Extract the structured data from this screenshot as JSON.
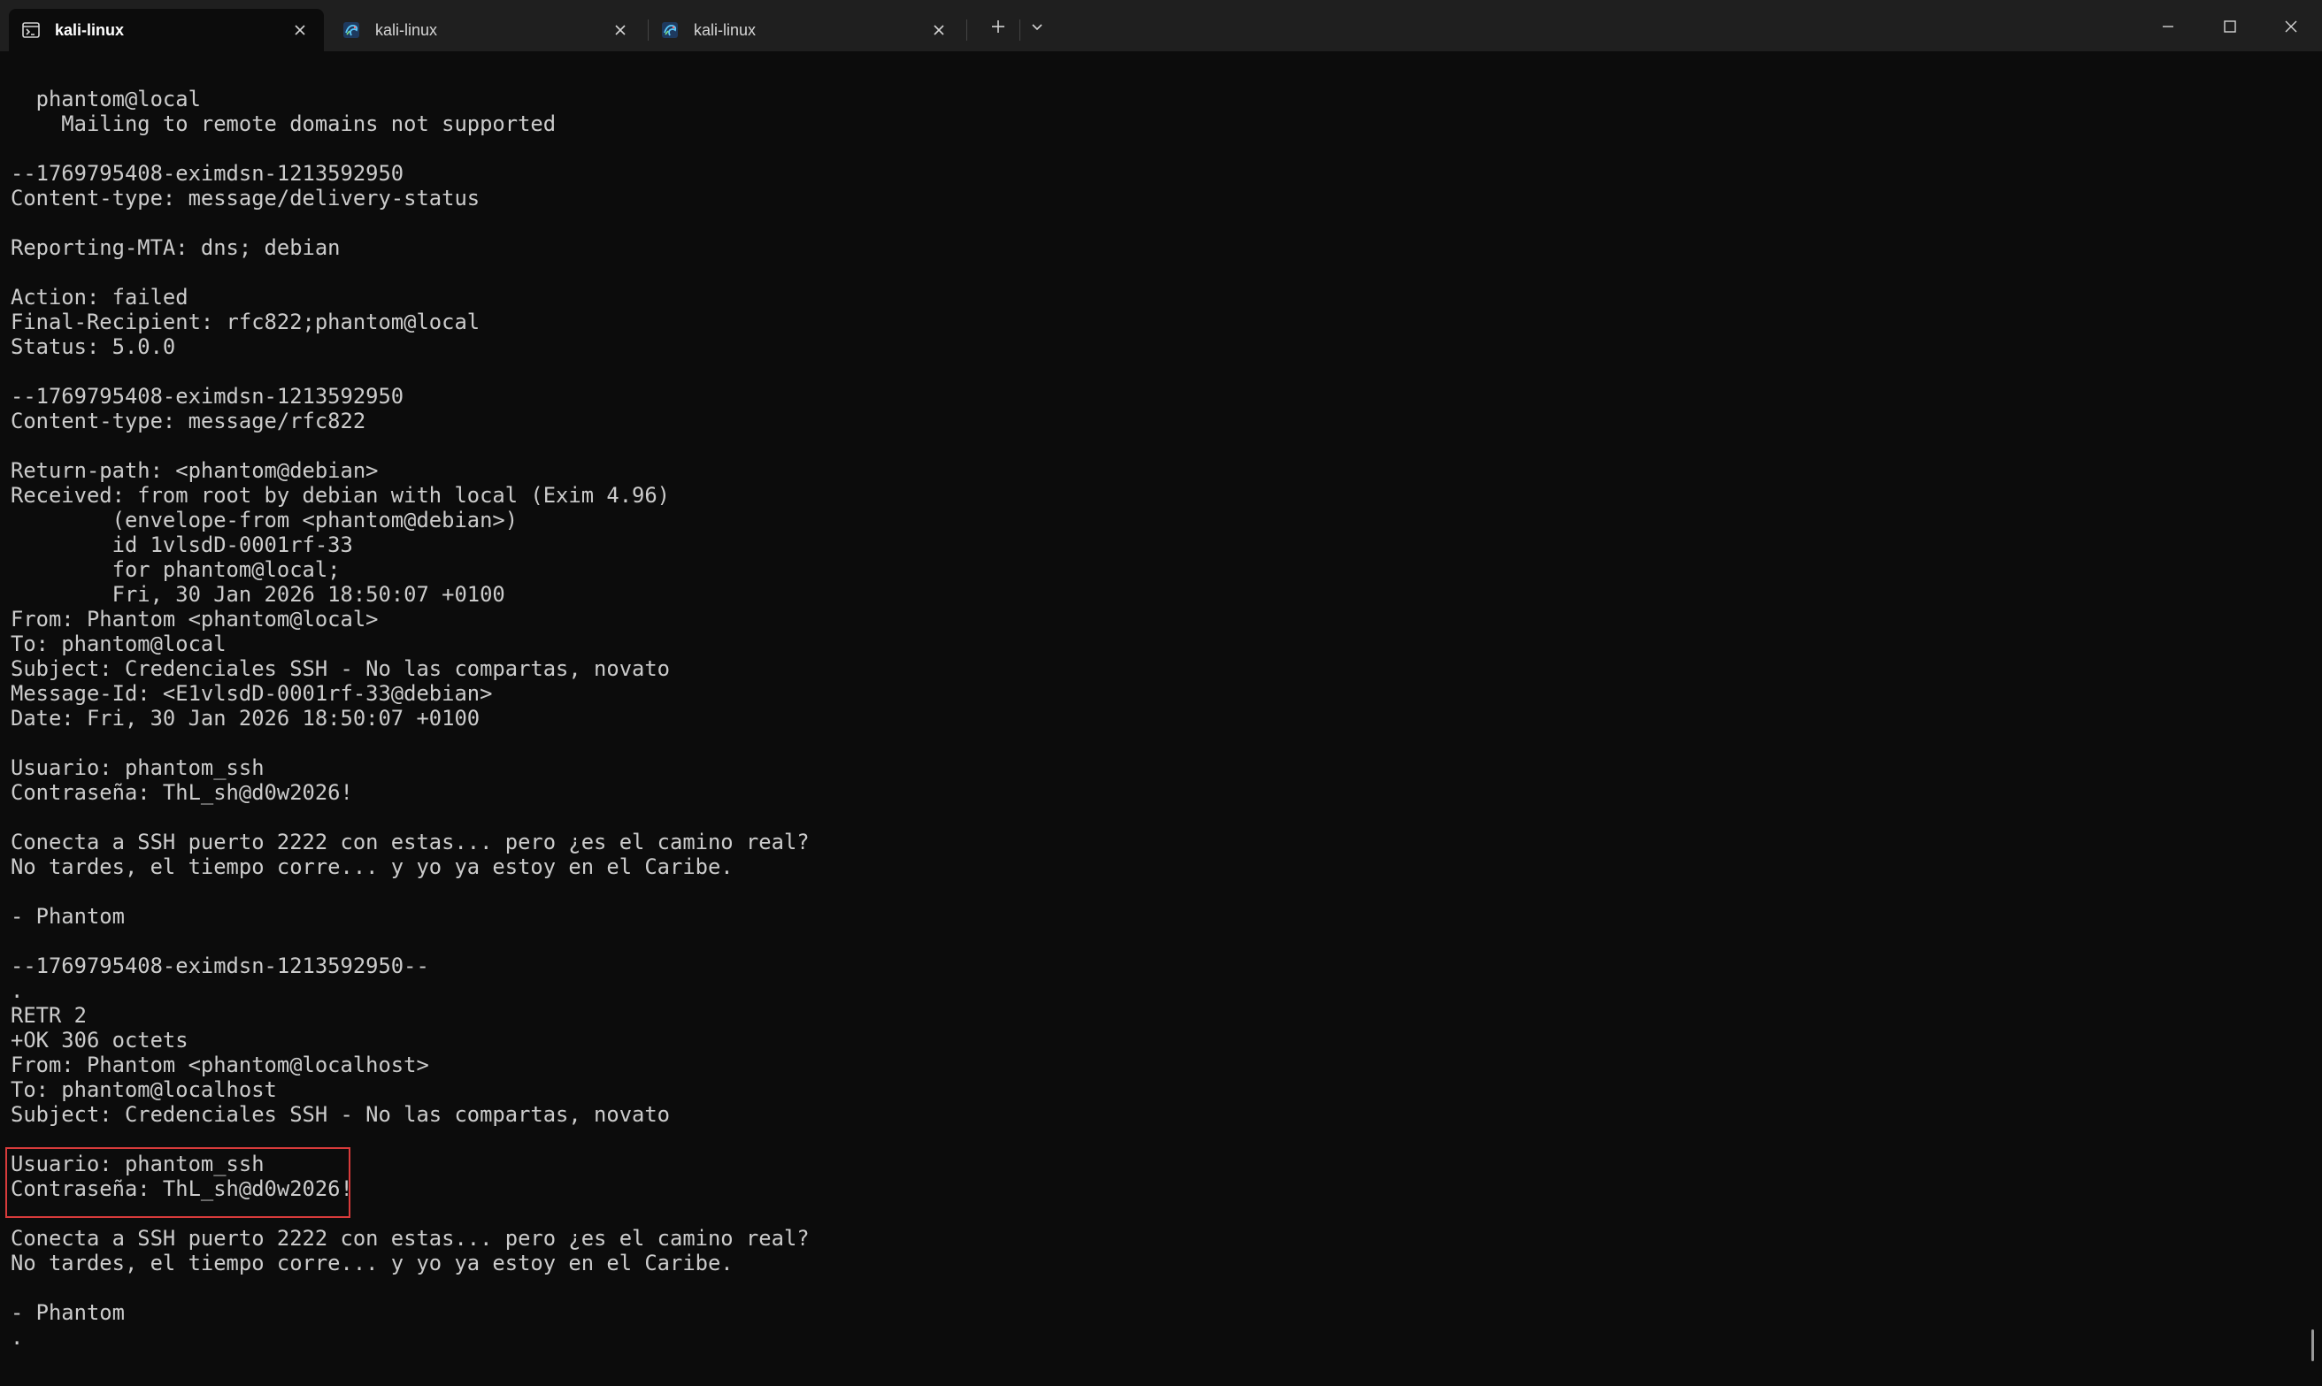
{
  "window": {
    "tabs": [
      {
        "label": "kali-linux",
        "active": true,
        "icon": "terminal-icon"
      },
      {
        "label": "kali-linux",
        "active": false,
        "icon": "kali-dragon-icon"
      },
      {
        "label": "kali-linux",
        "active": false,
        "icon": "kali-dragon-icon"
      }
    ],
    "controls": [
      "new-tab",
      "tab-dropdown",
      "minimize",
      "maximize",
      "close"
    ]
  },
  "colors": {
    "background": "#0c0c0c",
    "titlebar": "#1f1f1f",
    "text": "#cccccc",
    "highlight": "#d83b3b"
  },
  "terminal": {
    "lines": [
      "  phantom@local",
      "    Mailing to remote domains not supported",
      "",
      "--1769795408-eximdsn-1213592950",
      "Content-type: message/delivery-status",
      "",
      "Reporting-MTA: dns; debian",
      "",
      "Action: failed",
      "Final-Recipient: rfc822;phantom@local",
      "Status: 5.0.0",
      "",
      "--1769795408-eximdsn-1213592950",
      "Content-type: message/rfc822",
      "",
      "Return-path: <phantom@debian>",
      "Received: from root by debian with local (Exim 4.96)",
      "        (envelope-from <phantom@debian>)",
      "        id 1vlsdD-0001rf-33",
      "        for phantom@local;",
      "        Fri, 30 Jan 2026 18:50:07 +0100",
      "From: Phantom <phantom@local>",
      "To: phantom@local",
      "Subject: Credenciales SSH - No las compartas, novato",
      "Message-Id: <E1vlsdD-0001rf-33@debian>",
      "Date: Fri, 30 Jan 2026 18:50:07 +0100",
      "",
      "Usuario: phantom_ssh",
      "Contraseña: ThL_sh@d0w2026!",
      "",
      "Conecta a SSH puerto 2222 con estas... pero ¿es el camino real?",
      "No tardes, el tiempo corre... y yo ya estoy en el Caribe.",
      "",
      "- Phantom",
      "",
      "--1769795408-eximdsn-1213592950--",
      ".",
      "RETR 2",
      "+OK 306 octets",
      "From: Phantom <phantom@localhost>",
      "To: phantom@localhost",
      "Subject: Credenciales SSH - No las compartas, novato",
      "",
      "Usuario: phantom_ssh",
      "Contraseña: ThL_sh@d0w2026!",
      "",
      "Conecta a SSH puerto 2222 con estas... pero ¿es el camino real?",
      "No tardes, el tiempo corre... y yo ya estoy en el Caribe.",
      "",
      "- Phantom",
      "."
    ]
  }
}
